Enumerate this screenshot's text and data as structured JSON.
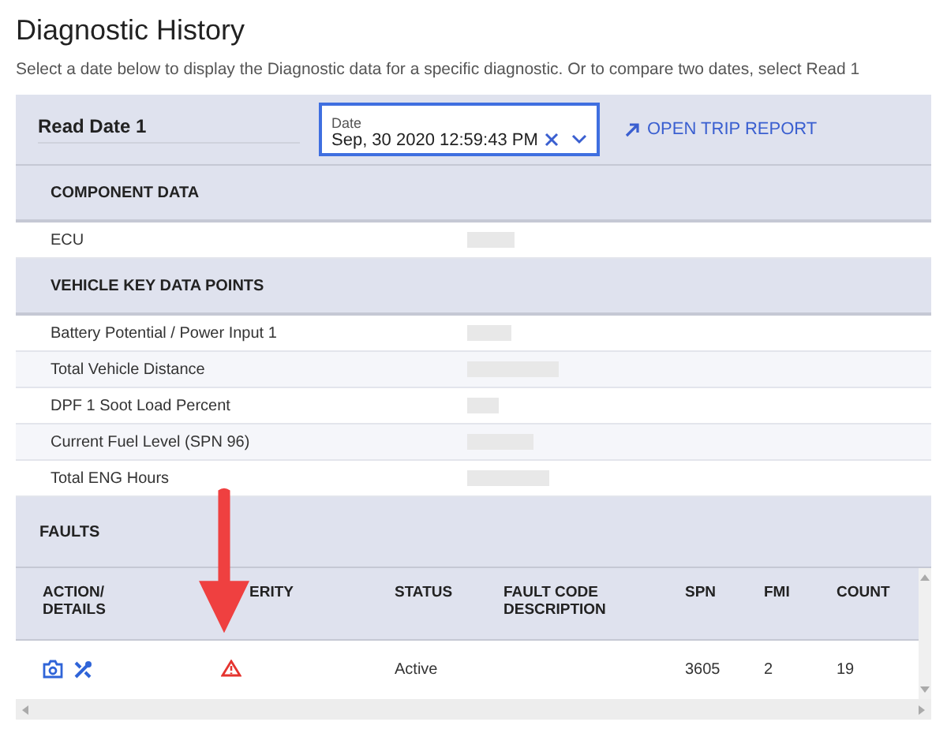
{
  "title": "Diagnostic History",
  "subtitle": "Select a date below to display the Diagnostic data for a specific diagnostic. Or to compare two dates, select Read 1",
  "read_date": {
    "label": "Read Date 1",
    "date_field": {
      "label": "Date",
      "value": "Sep, 30 2020 12:59:43 PM"
    },
    "link": "OPEN TRIP REPORT"
  },
  "sections": [
    {
      "title": "COMPONENT DATA",
      "rows": [
        {
          "label": "ECU"
        }
      ]
    },
    {
      "title": "VEHICLE KEY DATA POINTS",
      "rows": [
        {
          "label": "Battery Potential / Power Input 1"
        },
        {
          "label": "Total Vehicle Distance"
        },
        {
          "label": "DPF 1 Soot Load Percent"
        },
        {
          "label": "Current Fuel Level (SPN 96)"
        },
        {
          "label": "Total ENG Hours"
        }
      ]
    }
  ],
  "faults": {
    "title": "FAULTS",
    "columns": [
      "ACTION/ DETAILS",
      "ERITY",
      "STATUS",
      "FAULT CODE DESCRIPTION",
      "SPN",
      "FMI",
      "COUNT"
    ],
    "rows": [
      {
        "kind": "warning",
        "status": "Active",
        "spn": "3605",
        "fmi": "2",
        "count": "19"
      }
    ]
  }
}
